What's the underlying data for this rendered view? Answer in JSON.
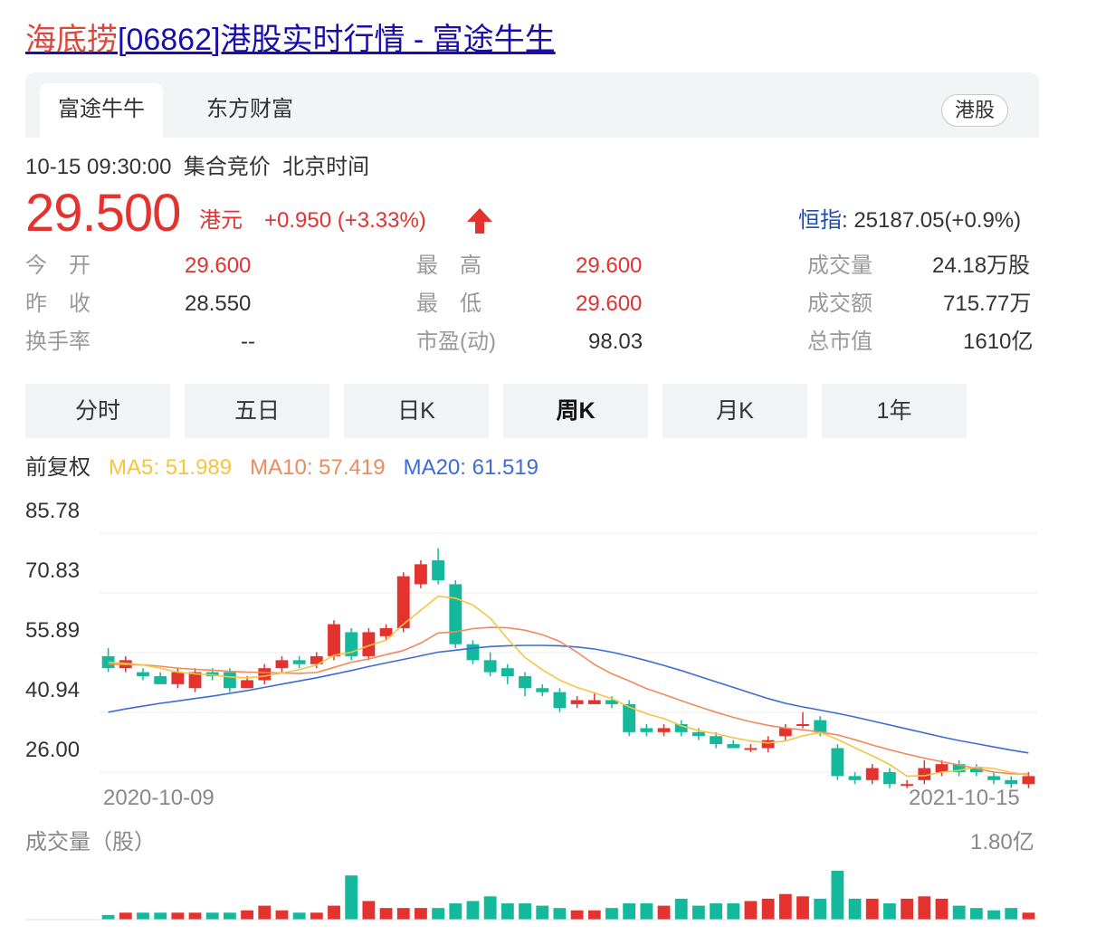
{
  "page": {
    "title_highlight": "海底捞",
    "title_rest": "[06862]港股实时行情 - 富途牛生"
  },
  "tabs": {
    "items": [
      "富途牛牛",
      "东方财富"
    ],
    "market": "港股"
  },
  "quote": {
    "time": "10-15 09:30:00",
    "session": "集合竞价",
    "timezone": "北京时间",
    "price": "29.500",
    "currency": "港元",
    "change": "+0.950 (+3.33%)",
    "index_name": "恒指",
    "index_value": ": 25187.05(+0.9%)",
    "stats": [
      {
        "label": "今　开",
        "value": "29.600",
        "up": true
      },
      {
        "label": "昨　收",
        "value": "28.550",
        "up": false
      },
      {
        "label": "换手率",
        "value": "--",
        "up": false
      },
      {
        "label": "最　高",
        "value": "29.600",
        "up": true
      },
      {
        "label": "最　低",
        "value": "29.600",
        "up": true
      },
      {
        "label": "市盈(动)",
        "value": "98.03",
        "up": false
      },
      {
        "label": "成交量",
        "value": "24.18万股",
        "up": false
      },
      {
        "label": "成交额",
        "value": "715.77万",
        "up": false
      },
      {
        "label": "总市值",
        "value": "1610亿",
        "up": false
      }
    ]
  },
  "periods": [
    "分时",
    "五日",
    "日K",
    "周K",
    "月K",
    "1年"
  ],
  "active_period": "周K",
  "ma": {
    "adjust": "前复权",
    "ma5": "MA5: 51.989",
    "ma10": "MA10: 57.419",
    "ma20": "MA20: 61.519"
  },
  "colors": {
    "up": "#e4322f",
    "down": "#14b89a",
    "ma5": "#f5c542",
    "ma10": "#f08a5d",
    "ma20": "#3c6bd7"
  },
  "chart_data": {
    "type": "candlestick",
    "y_ticks": [
      "85.78",
      "70.83",
      "55.89",
      "40.94",
      "26.00"
    ],
    "ylim": [
      26.0,
      85.78
    ],
    "x_start_label": "2020-10-09",
    "x_end_label": "2021-10-15",
    "candles": [
      [
        55,
        52,
        57,
        51
      ],
      [
        52,
        54,
        55,
        51
      ],
      [
        51,
        50,
        52,
        49
      ],
      [
        50,
        48,
        51,
        48
      ],
      [
        48,
        51,
        52,
        47
      ],
      [
        47,
        51,
        52,
        46
      ],
      [
        51,
        50,
        52,
        49
      ],
      [
        51,
        47,
        52,
        46
      ],
      [
        47,
        49,
        50,
        47
      ],
      [
        49,
        52,
        53,
        48
      ],
      [
        52,
        54,
        55,
        51
      ],
      [
        54,
        53,
        55,
        52
      ],
      [
        53,
        55,
        56,
        52
      ],
      [
        55,
        63,
        64,
        54
      ],
      [
        61,
        55,
        62,
        54
      ],
      [
        55,
        61,
        62,
        54
      ],
      [
        60,
        62,
        63,
        59
      ],
      [
        62,
        75,
        76,
        61
      ],
      [
        73,
        78,
        79,
        72
      ],
      [
        79,
        74,
        82,
        73
      ],
      [
        73,
        58,
        74,
        57
      ],
      [
        58,
        54,
        59,
        53
      ],
      [
        54,
        51,
        56,
        50
      ],
      [
        52,
        50,
        53,
        48
      ],
      [
        50,
        47,
        51,
        45
      ],
      [
        47,
        46,
        48,
        45
      ],
      [
        46,
        42,
        47,
        41
      ],
      [
        43,
        44,
        45,
        42
      ],
      [
        43,
        44,
        46,
        43
      ],
      [
        44,
        43,
        45,
        42
      ],
      [
        43,
        36,
        44,
        35
      ],
      [
        37,
        36,
        38,
        35
      ],
      [
        36,
        37,
        38,
        35
      ],
      [
        38,
        36,
        39,
        35
      ],
      [
        36,
        35,
        37,
        34
      ],
      [
        35,
        33,
        36,
        32
      ],
      [
        33,
        32,
        34,
        32
      ],
      [
        32,
        32,
        33,
        31
      ],
      [
        32,
        34,
        35,
        31
      ],
      [
        35,
        37,
        38,
        34
      ],
      [
        38,
        38,
        41,
        37
      ],
      [
        39,
        36,
        40,
        35
      ],
      [
        32,
        25,
        33,
        24
      ],
      [
        25,
        24,
        26,
        23
      ],
      [
        24,
        27,
        28,
        23
      ],
      [
        26,
        23,
        27,
        22
      ],
      [
        23,
        23,
        24,
        22
      ],
      [
        24,
        27,
        29,
        23
      ],
      [
        26,
        28,
        29,
        25
      ],
      [
        28,
        26,
        29,
        25
      ],
      [
        27,
        26,
        28,
        25
      ],
      [
        25,
        24,
        26,
        23
      ],
      [
        24,
        23,
        25,
        22
      ],
      [
        23,
        25,
        26,
        22
      ]
    ],
    "ma5": [
      53.5,
      53.2,
      52.8,
      52.0,
      51.0,
      50.6,
      50.3,
      49.8,
      49.6,
      50.0,
      50.8,
      51.6,
      52.8,
      55.2,
      56.0,
      57.6,
      59.0,
      63.0,
      66.5,
      70.0,
      69.5,
      67.8,
      64.5,
      59.3,
      54.7,
      51.6,
      49.0,
      47.2,
      45.8,
      44.4,
      42.3,
      40.6,
      39.4,
      37.6,
      36.4,
      35.6,
      34.6,
      33.8,
      33.3,
      33.8,
      35.1,
      35.9,
      34.2,
      32.1,
      30.1,
      27.9,
      25.0,
      25.1,
      26.0,
      26.4,
      27.3,
      26.9,
      25.9,
      25.2
    ],
    "ma10": [
      53.0,
      52.9,
      52.8,
      52.5,
      52.0,
      51.7,
      51.5,
      51.2,
      51.0,
      50.9,
      50.8,
      50.7,
      50.9,
      52.2,
      53.5,
      54.3,
      55.4,
      56.4,
      58.3,
      60.8,
      61.1,
      61.9,
      62.2,
      62.1,
      61.5,
      60.4,
      58.7,
      56.0,
      52.9,
      50.6,
      48.8,
      46.9,
      45.4,
      43.9,
      42.4,
      41.0,
      39.7,
      38.6,
      37.7,
      37.0,
      36.6,
      36.0,
      35.3,
      34.1,
      32.8,
      31.6,
      30.5,
      29.5,
      28.6,
      27.8,
      26.9,
      26.0,
      25.6,
      25.5
    ],
    "ma20": [
      41.0,
      41.8,
      42.5,
      43.2,
      43.8,
      44.4,
      45.0,
      45.7,
      46.4,
      47.2,
      48.0,
      48.8,
      49.6,
      50.5,
      51.4,
      52.4,
      53.3,
      54.2,
      55.1,
      56.0,
      56.5,
      57.0,
      57.4,
      57.6,
      57.7,
      57.7,
      57.6,
      57.3,
      56.8,
      56.0,
      55.0,
      53.9,
      52.7,
      51.4,
      50.0,
      48.6,
      47.2,
      45.8,
      44.4,
      43.2,
      42.3,
      41.5,
      40.7,
      39.8,
      38.8,
      37.8,
      36.8,
      35.8,
      34.8,
      33.9,
      33.1,
      32.3,
      31.5,
      30.8
    ],
    "volume_max_label": "1.80亿",
    "volume_title": "成交量（股）",
    "volumes": [
      0.02,
      0.03,
      0.03,
      0.03,
      0.03,
      0.03,
      0.03,
      0.03,
      0.04,
      0.06,
      0.04,
      0.03,
      0.03,
      0.06,
      0.19,
      0.08,
      0.05,
      0.05,
      0.05,
      0.05,
      0.07,
      0.08,
      0.1,
      0.07,
      0.07,
      0.06,
      0.05,
      0.04,
      0.04,
      0.05,
      0.07,
      0.07,
      0.06,
      0.09,
      0.06,
      0.07,
      0.07,
      0.08,
      0.09,
      0.11,
      0.1,
      0.09,
      0.21,
      0.09,
      0.09,
      0.07,
      0.09,
      0.1,
      0.09,
      0.06,
      0.05,
      0.04,
      0.05,
      0.03
    ]
  }
}
